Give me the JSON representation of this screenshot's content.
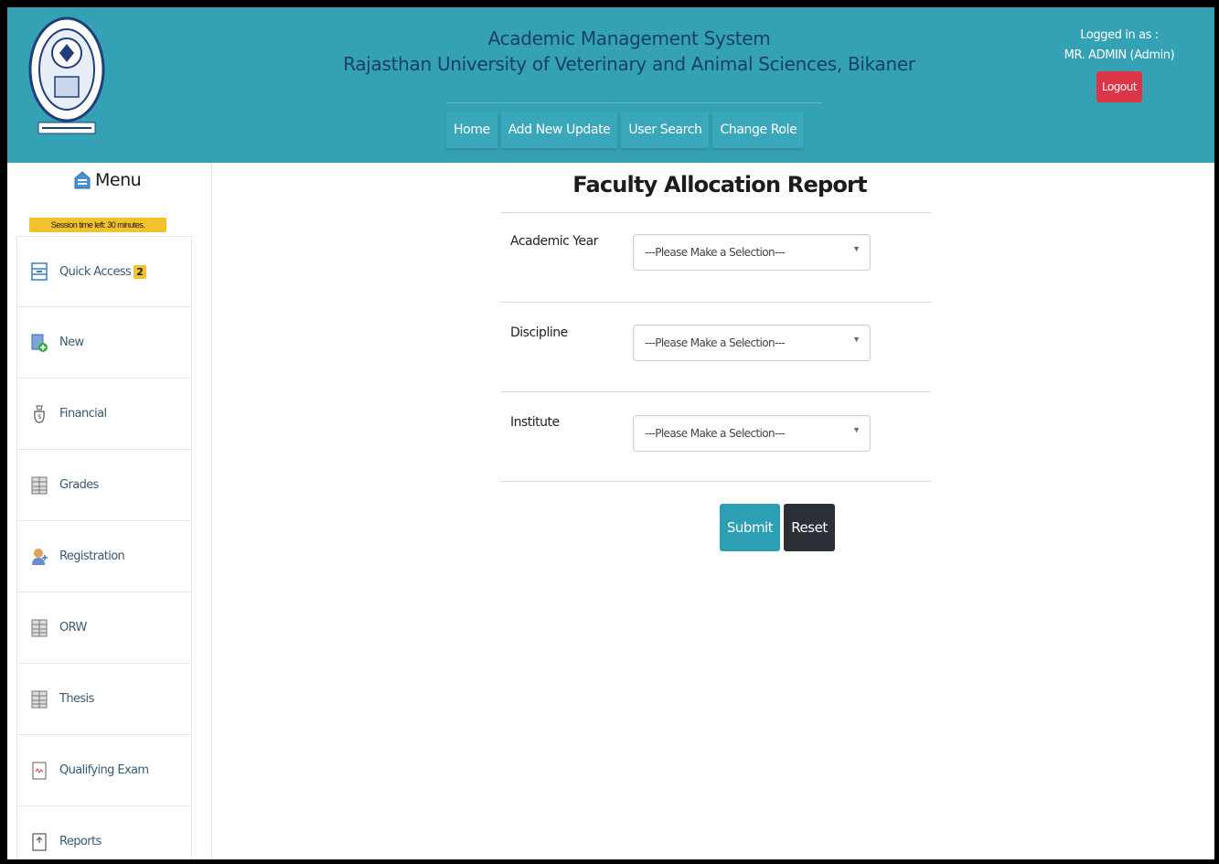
{
  "header": {
    "title_line1": "Academic Management System",
    "title_line2": "Rajasthan University of Veterinary and Animal Sciences, Bikaner",
    "nav": [
      {
        "label": "Home"
      },
      {
        "label": "Add New Update"
      },
      {
        "label": "User Search"
      },
      {
        "label": "Change Role"
      }
    ],
    "user": {
      "logged_in_label": "Logged in as :",
      "name": "MR. ADMIN (Admin)",
      "logout_label": "Logout"
    },
    "colors": {
      "background": "#35a1b4",
      "title_text": "#173f6b",
      "logout": "#dc3545"
    }
  },
  "sidebar": {
    "menu_label": "Menu",
    "session_text": "Session time left: 30 minutes.",
    "items": [
      {
        "label": "Quick Access",
        "badge": "2",
        "icon": "archive-box-icon"
      },
      {
        "label": "New",
        "icon": "new-document-icon"
      },
      {
        "label": "Financial",
        "icon": "financial-bag-icon"
      },
      {
        "label": "Grades",
        "icon": "grid-sheet-icon"
      },
      {
        "label": "Registration",
        "icon": "user-add-icon"
      },
      {
        "label": "ORW",
        "icon": "grid-sheet-icon"
      },
      {
        "label": "Thesis",
        "icon": "grid-sheet-icon"
      },
      {
        "label": "Qualifying Exam",
        "icon": "exam-document-icon"
      },
      {
        "label": "Reports",
        "icon": "report-document-icon"
      }
    ]
  },
  "main": {
    "page_title": "Faculty Allocation Report",
    "fields": [
      {
        "label": "Academic Year",
        "value": "---Please Make a Selection---"
      },
      {
        "label": "Discipline",
        "value": "---Please Make a Selection---"
      },
      {
        "label": "Institute",
        "value": "---Please Make a Selection---"
      }
    ],
    "submit_label": "Submit",
    "reset_label": "Reset",
    "colors": {
      "submit": "#2c9fb5",
      "reset": "#2b3036"
    }
  }
}
